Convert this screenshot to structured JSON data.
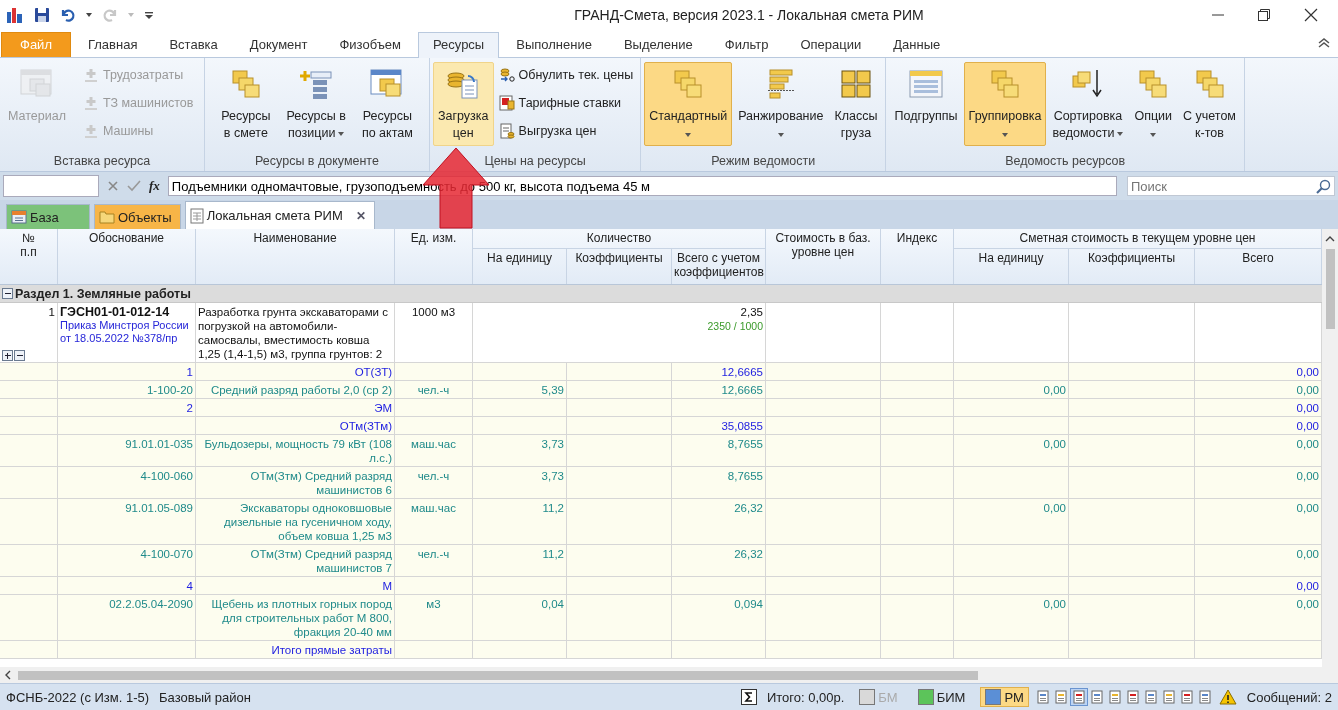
{
  "window": {
    "title": "ГРАНД-Смета, версия 2023.1 - Локальная смета РИМ"
  },
  "ribbon_tabs": [
    {
      "label": "Файл",
      "kind": "file",
      "selected": false
    },
    {
      "label": "Главная",
      "kind": "tab",
      "selected": false
    },
    {
      "label": "Вставка",
      "kind": "tab",
      "selected": false
    },
    {
      "label": "Документ",
      "kind": "tab",
      "selected": false
    },
    {
      "label": "Физобъем",
      "kind": "tab",
      "selected": false
    },
    {
      "label": "Ресурсы",
      "kind": "tab",
      "selected": true
    },
    {
      "label": "Выполнение",
      "kind": "tab",
      "selected": false
    },
    {
      "label": "Выделение",
      "kind": "tab",
      "selected": false
    },
    {
      "label": "Фильтр",
      "kind": "tab",
      "selected": false
    },
    {
      "label": "Операции",
      "kind": "tab",
      "selected": false
    },
    {
      "label": "Данные",
      "kind": "tab",
      "selected": false
    }
  ],
  "ribbon_groups": [
    {
      "title": "Вставка ресурса",
      "large": [
        {
          "label": "Материал",
          "disabled": true,
          "selected": false,
          "hovered": false,
          "dropdown": false
        }
      ],
      "small": [
        {
          "label": "Трудозатраты",
          "disabled": true
        },
        {
          "label": "ТЗ машинистов",
          "disabled": true
        },
        {
          "label": "Машины",
          "disabled": true
        }
      ]
    },
    {
      "title": "Ресурсы в документе",
      "large": [
        {
          "label": "Ресурсы\nв смете",
          "disabled": false,
          "selected": false,
          "hovered": false,
          "dropdown": false
        },
        {
          "label": "Ресурсы в\nпозиции",
          "disabled": false,
          "selected": false,
          "hovered": false,
          "dropdown": true
        },
        {
          "label": "Ресурсы\nпо актам",
          "disabled": false,
          "selected": false,
          "hovered": false,
          "dropdown": false
        }
      ]
    },
    {
      "title": "Цены на ресурсы",
      "large": [
        {
          "label": "Загрузка\nцен",
          "disabled": false,
          "selected": false,
          "hovered": true,
          "dropdown": false
        }
      ],
      "small": [
        {
          "label": "Обнулить тек. цены",
          "disabled": false
        },
        {
          "label": "Тарифные ставки",
          "disabled": false
        },
        {
          "label": "Выгрузка цен",
          "disabled": false
        }
      ]
    },
    {
      "title": "Режим ведомости",
      "large": [
        {
          "label": "Стандартный",
          "disabled": false,
          "selected": true,
          "hovered": false,
          "dropdown": true
        },
        {
          "label": "Ранжирование",
          "disabled": false,
          "selected": false,
          "hovered": false,
          "dropdown": true
        },
        {
          "label": "Классы\nгруза",
          "disabled": false,
          "selected": false,
          "hovered": false,
          "dropdown": false
        }
      ]
    },
    {
      "title": "Ведомость ресурсов",
      "large": [
        {
          "label": "Подгруппы",
          "disabled": false,
          "selected": false,
          "hovered": false,
          "dropdown": false
        },
        {
          "label": "Группировка",
          "disabled": false,
          "selected": true,
          "hovered": false,
          "dropdown": true
        },
        {
          "label": "Сортировка\nведомости",
          "disabled": false,
          "selected": false,
          "hovered": false,
          "dropdown": true
        },
        {
          "label": "Опции",
          "disabled": false,
          "selected": false,
          "hovered": false,
          "dropdown": true
        },
        {
          "label": "С учетом\nк-тов",
          "disabled": false,
          "selected": false,
          "hovered": false,
          "dropdown": false
        }
      ]
    }
  ],
  "formula_bar": {
    "fx": "fx",
    "value": "Подъемники одномачтовые, грузоподъемность до 500 кг, высота подъема 45 м",
    "search_placeholder": "Поиск"
  },
  "doc_tabs": [
    {
      "label": "База",
      "color": "#7cc27a",
      "selected": false,
      "closable": false
    },
    {
      "label": "Объекты",
      "color": "#f7b547",
      "selected": false,
      "closable": false
    },
    {
      "label": "Локальная смета РИМ",
      "color": "#ffffff",
      "selected": true,
      "closable": true
    }
  ],
  "close_glyph": "✕",
  "table": {
    "columns": [
      {
        "label": "№\nп.п"
      },
      {
        "label": "Обоснование"
      },
      {
        "label": "Наименование"
      },
      {
        "label": "Ед. изм."
      },
      {
        "label": "Количество",
        "children": [
          {
            "label": "На единицу"
          },
          {
            "label": "Коэффициенты"
          },
          {
            "label": "Всего с учетом коэффициентов"
          }
        ]
      },
      {
        "label": "Стоимость в баз. уровне цен"
      },
      {
        "label": "Индекс"
      },
      {
        "label": "Сметная стоимость в текущем уровне цен",
        "children": [
          {
            "label": "На единицу"
          },
          {
            "label": "Коэффициенты"
          },
          {
            "label": "Всего"
          }
        ]
      }
    ],
    "rows": [
      {
        "kind": "section",
        "title": "Раздел 1. Земляные работы",
        "expanded": true
      },
      {
        "kind": "item",
        "num": "1",
        "code": "ГЭСН01-01-012-14",
        "code_note": "Приказ Минстроя России от 18.05.2022 №378/пр",
        "name": "Разработка грунта экскаваторами с погрузкой на автомобили-самосвалы, вместимость ковша 1,25 (1,4-1,5) м3, группа грунтов: 2",
        "unit": "1000 м3",
        "qty_total": "2,35",
        "qty_formula": "2350 / 1000",
        "expanded": true
      },
      {
        "kind": "group",
        "code": "1",
        "name": "ОТ(ЗТ)",
        "qty_total": "12,6665",
        "cur_total": "0,00"
      },
      {
        "kind": "resource",
        "code": "1-100-20",
        "name": "Средний разряд работы 2,0 (ср 2)",
        "unit": "чел.-ч",
        "qty_unit": "5,39",
        "qty_total": "12,6665",
        "cur_unit": "0,00",
        "cur_total": "0,00"
      },
      {
        "kind": "group",
        "code": "2",
        "name": "ЭМ",
        "cur_total": "0,00"
      },
      {
        "kind": "group",
        "name": "ОТм(ЗТм)",
        "qty_total": "35,0855",
        "cur_total": "0,00"
      },
      {
        "kind": "resource",
        "code": "91.01.01-035",
        "name": "Бульдозеры, мощность 79 кВт (108 л.с.)",
        "unit": "маш.час",
        "qty_unit": "3,73",
        "qty_total": "8,7655",
        "cur_unit": "0,00",
        "cur_total": "0,00"
      },
      {
        "kind": "resource",
        "code": "4-100-060",
        "name": "ОТм(Зтм) Средний разряд машинистов 6",
        "unit": "чел.-ч",
        "qty_unit": "3,73",
        "qty_total": "8,7655",
        "cur_total": "0,00"
      },
      {
        "kind": "resource",
        "code": "91.01.05-089",
        "name": "Экскаваторы одноковшовые дизельные на гусеничном ходу, объем ковша 1,25 м3",
        "unit": "маш.час",
        "qty_unit": "11,2",
        "qty_total": "26,32",
        "cur_unit": "0,00",
        "cur_total": "0,00"
      },
      {
        "kind": "resource",
        "code": "4-100-070",
        "name": "ОТм(Зтм) Средний разряд машинистов 7",
        "unit": "чел.-ч",
        "qty_unit": "11,2",
        "qty_total": "26,32",
        "cur_total": "0,00"
      },
      {
        "kind": "group",
        "code": "4",
        "name": "М",
        "cur_total": "0,00"
      },
      {
        "kind": "resource",
        "code": "02.2.05.04-2090",
        "name": "Щебень из плотных горных пород для строительных работ М 800, фракция 20-40 мм",
        "unit": "м3",
        "qty_unit": "0,04",
        "qty_total": "0,094",
        "cur_unit": "0,00",
        "cur_total": "0,00"
      },
      {
        "kind": "group",
        "name": "Итого прямые затраты"
      }
    ]
  },
  "status_bar": {
    "norms": "ФСНБ-2022 (с Изм. 1-5)",
    "region": "Базовый район",
    "total": "Итого: 0,00р.",
    "modes": [
      {
        "label": "БМ",
        "color": "#d9d9d9",
        "selected": false,
        "disabled": true
      },
      {
        "label": "БИМ",
        "color": "#5cc45a",
        "selected": false,
        "disabled": false
      },
      {
        "label": "РМ",
        "color": "#5b8fd6",
        "selected": true,
        "disabled": false
      }
    ],
    "tools": [
      {
        "selected": false
      },
      {
        "selected": false
      },
      {
        "selected": true
      },
      {
        "selected": false
      },
      {
        "selected": false
      },
      {
        "selected": false
      },
      {
        "selected": false
      },
      {
        "selected": false
      },
      {
        "selected": false
      },
      {
        "selected": false
      }
    ],
    "messages": "Сообщений: 2"
  }
}
